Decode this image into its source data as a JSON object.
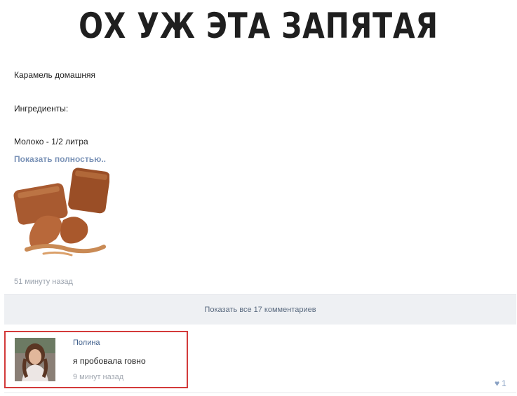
{
  "meme_title": "ОХ УЖ ЭТА ЗАПЯТАЯ",
  "post": {
    "line1": "Карамель домашняя",
    "line2": "Ингредиенты:",
    "line3": "Молоко - 1/2 литра",
    "show_full": "Показать полностью..",
    "image_alt": "caramel-candies-photo",
    "timestamp": "51 минуту назад"
  },
  "comments_bar": {
    "label": "Показать все 17 комментариев"
  },
  "comment": {
    "author": "Полина",
    "text": "я пробовала говно",
    "time": "9 минут назад",
    "likes": "1"
  },
  "colors": {
    "link": "#7b93b7",
    "highlight_border": "#d33a3a",
    "bar_bg": "#eef0f3"
  }
}
